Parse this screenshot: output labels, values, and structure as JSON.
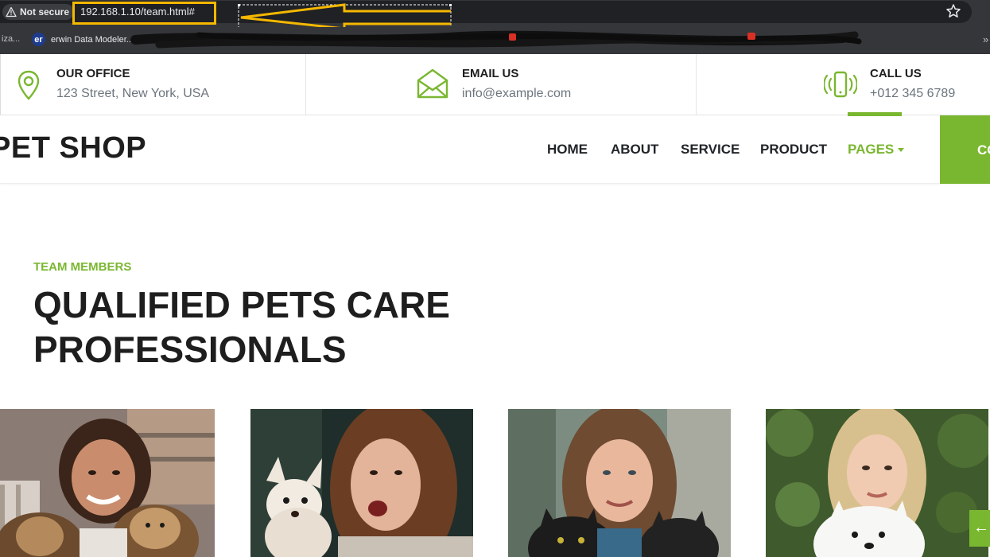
{
  "browser": {
    "security_label": "Not secure",
    "url": "192.168.1.10/team.html#",
    "bookmarks": {
      "partial": "iza...",
      "erwin_logo_text": "er",
      "erwin_label": "erwin Data Modeler...",
      "more": "»"
    }
  },
  "info_bar": {
    "office": {
      "title": "OUR OFFICE",
      "value": "123 Street, New York, USA",
      "icon": "map-pin-icon"
    },
    "email": {
      "title": "EMAIL US",
      "value": "info@example.com",
      "icon": "envelope-icon"
    },
    "call": {
      "title": "CALL US",
      "value": "+012 345 6789",
      "icon": "phone-ringing-icon"
    }
  },
  "navbar": {
    "brand": "PET SHOP",
    "links": [
      "HOME",
      "ABOUT",
      "SERVICE",
      "PRODUCT",
      "PAGES"
    ],
    "active": "PAGES",
    "cta": "CONTACT"
  },
  "team": {
    "subtitle": "TEAM MEMBERS",
    "heading": "QUALIFIED PETS CARE PROFESSIONALS"
  },
  "colors": {
    "accent": "#7ab730",
    "dark_text": "#1e1e1e",
    "muted_text": "#6c757d",
    "annotation_yellow": "#f5b800"
  },
  "back_to_top_icon": "arrow-left-icon"
}
